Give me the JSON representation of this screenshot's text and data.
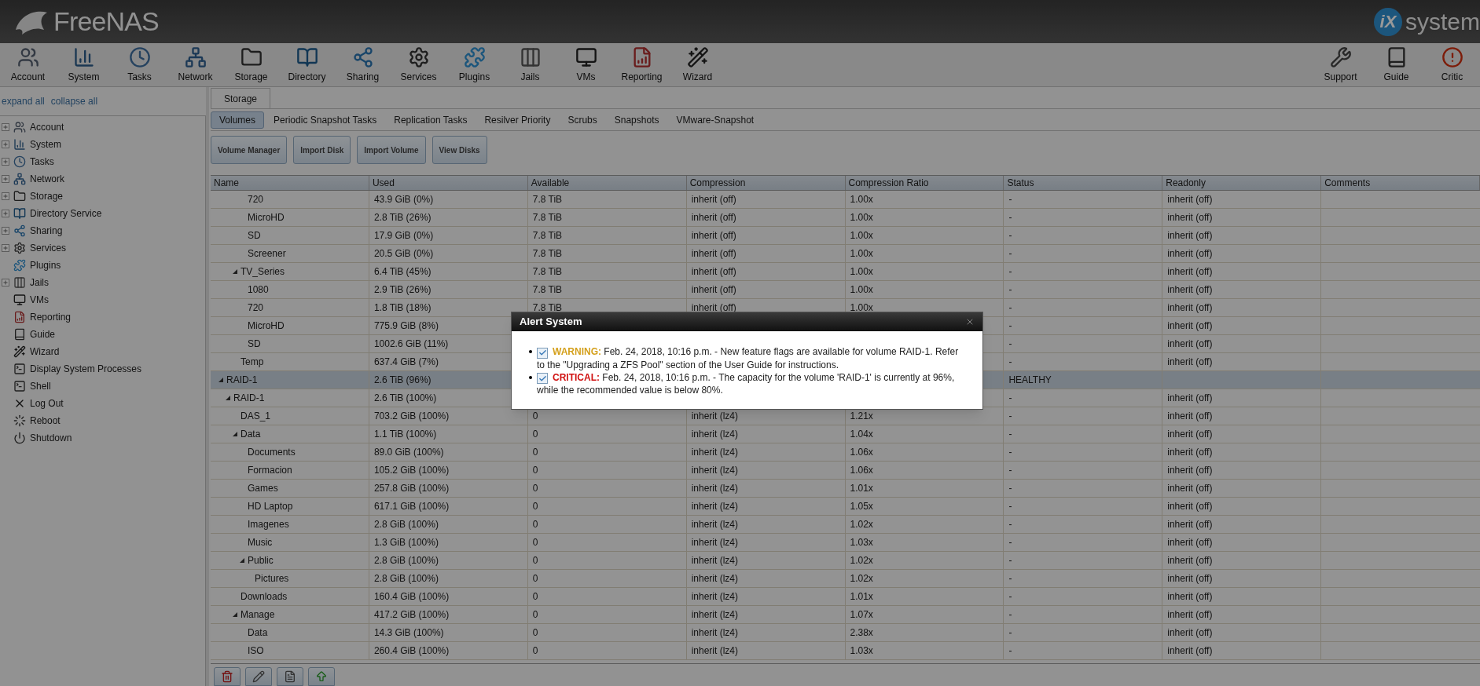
{
  "header": {
    "logo": "FreeNAS",
    "brand_mark": "iX",
    "brand_text": "system"
  },
  "toolbar": {
    "left": [
      "Account",
      "System",
      "Tasks",
      "Network",
      "Storage",
      "Directory",
      "Sharing",
      "Services",
      "Plugins",
      "Jails",
      "VMs",
      "Reporting",
      "Wizard"
    ],
    "right": [
      "Support",
      "Guide",
      "Critic"
    ]
  },
  "sidebar": {
    "links": [
      "expand all",
      "collapse all"
    ],
    "items": [
      {
        "label": "Account",
        "kind": "group",
        "expanded": false
      },
      {
        "label": "System",
        "kind": "group",
        "expanded": false
      },
      {
        "label": "Tasks",
        "kind": "group",
        "expanded": false
      },
      {
        "label": "Network",
        "kind": "group",
        "expanded": false
      },
      {
        "label": "Storage",
        "kind": "group",
        "expanded": false
      },
      {
        "label": "Directory Service",
        "kind": "group",
        "expanded": false
      },
      {
        "label": "Sharing",
        "kind": "group",
        "expanded": false
      },
      {
        "label": "Services",
        "kind": "group",
        "expanded": false
      },
      {
        "label": "Plugins",
        "kind": "item"
      },
      {
        "label": "Jails",
        "kind": "group",
        "expanded": false
      },
      {
        "label": "VMs",
        "kind": "item"
      },
      {
        "label": "Reporting",
        "kind": "item"
      },
      {
        "label": "Guide",
        "kind": "item"
      },
      {
        "label": "Wizard",
        "kind": "item"
      },
      {
        "label": "Display System Processes",
        "kind": "item"
      },
      {
        "label": "Shell",
        "kind": "item"
      },
      {
        "label": "Log Out",
        "kind": "item"
      },
      {
        "label": "Reboot",
        "kind": "item"
      },
      {
        "label": "Shutdown",
        "kind": "item"
      }
    ]
  },
  "main_tab": {
    "label": "Storage",
    "selected": true
  },
  "subtabs": [
    {
      "label": "Volumes",
      "selected": true
    },
    {
      "label": "Periodic Snapshot Tasks",
      "selected": false
    },
    {
      "label": "Replication Tasks",
      "selected": false
    },
    {
      "label": "Resilver Priority",
      "selected": false
    },
    {
      "label": "Scrubs",
      "selected": false
    },
    {
      "label": "Snapshots",
      "selected": false
    },
    {
      "label": "VMware-Snapshot",
      "selected": false
    }
  ],
  "buttons": [
    "Volume Manager",
    "Import Disk",
    "Import Volume",
    "View Disks"
  ],
  "table": {
    "columns": [
      "Name",
      "Used",
      "Available",
      "Compression",
      "Compression Ratio",
      "Status",
      "Readonly",
      "Comments"
    ],
    "rows": [
      {
        "children": [
          {
            "children": [
              {
                "children": [
                  {
                    "kind": "dataset",
                    "name": "720",
                    "used": "43.9 GiB (0%)",
                    "available": "7.8 TiB",
                    "compression": "inherit (off)",
                    "ratio": "1.00x",
                    "status": "-",
                    "readonly": "inherit (off)"
                  },
                  {
                    "kind": "dataset",
                    "name": "MicroHD",
                    "used": "2.8 TiB (26%)",
                    "available": "7.8 TiB",
                    "compression": "inherit (off)",
                    "ratio": "1.00x",
                    "status": "-",
                    "readonly": "inherit (off)"
                  },
                  {
                    "kind": "dataset",
                    "name": "SD",
                    "used": "17.9 GiB (0%)",
                    "available": "7.8 TiB",
                    "compression": "inherit (off)",
                    "ratio": "1.00x",
                    "status": "-",
                    "readonly": "inherit (off)"
                  },
                  {
                    "kind": "dataset",
                    "name": "Screener",
                    "used": "20.5 GiB (0%)",
                    "available": "7.8 TiB",
                    "compression": "inherit (off)",
                    "ratio": "1.00x",
                    "status": "-",
                    "readonly": "inherit (off)"
                  }
                ]
              },
              {
                "kind": "dataset",
                "name": "TV_Series",
                "expanded": true,
                "used": "6.4 TiB (45%)",
                "available": "7.8 TiB",
                "compression": "inherit (off)",
                "ratio": "1.00x",
                "status": "-",
                "readonly": "inherit (off)",
                "children": [
                  {
                    "kind": "dataset",
                    "name": "1080",
                    "used": "2.9 TiB (26%)",
                    "available": "7.8 TiB",
                    "compression": "inherit (off)",
                    "ratio": "1.00x",
                    "status": "-",
                    "readonly": "inherit (off)"
                  },
                  {
                    "kind": "dataset",
                    "name": "720",
                    "used": "1.8 TiB (18%)",
                    "available": "7.8 TiB",
                    "compression": "inherit (off)",
                    "ratio": "1.00x",
                    "status": "-",
                    "readonly": "inherit (off)"
                  },
                  {
                    "kind": "dataset",
                    "name": "MicroHD",
                    "used": "775.9 GiB (8%)",
                    "status": "-",
                    "readonly": "inherit (off)"
                  },
                  {
                    "kind": "dataset",
                    "name": "SD",
                    "used": "1002.6 GiB (11%)",
                    "status": "-",
                    "readonly": "inherit (off)"
                  }
                ]
              },
              {
                "kind": "dataset",
                "name": "Temp",
                "used": "637.4 GiB (7%)",
                "status": "-",
                "readonly": "inherit (off)"
              }
            ]
          }
        ]
      },
      {
        "kind": "volume",
        "name": "RAID-1",
        "expanded": true,
        "used": "2.6 TiB (96%)",
        "status": "HEALTHY",
        "children": [
          {
            "kind": "dataset",
            "name": "RAID-1",
            "expanded": true,
            "used": "2.6 TiB (100%)",
            "status": "-",
            "readonly": "inherit (off)",
            "children": [
              {
                "kind": "dataset",
                "name": "DAS_1",
                "used": "703.2 GiB (100%)",
                "available": "0",
                "compression": "inherit (lz4)",
                "ratio": "1.21x",
                "status": "-",
                "readonly": "inherit (off)"
              },
              {
                "kind": "dataset",
                "name": "Data",
                "expanded": true,
                "used": "1.1 TiB (100%)",
                "available": "0",
                "compression": "inherit (lz4)",
                "ratio": "1.04x",
                "status": "-",
                "readonly": "inherit (off)",
                "children": [
                  {
                    "kind": "dataset",
                    "name": "Documents",
                    "used": "89.0 GiB (100%)",
                    "available": "0",
                    "compression": "inherit (lz4)",
                    "ratio": "1.06x",
                    "status": "-",
                    "readonly": "inherit (off)"
                  },
                  {
                    "kind": "dataset",
                    "name": "Formacion",
                    "used": "105.2 GiB (100%)",
                    "available": "0",
                    "compression": "inherit (lz4)",
                    "ratio": "1.06x",
                    "status": "-",
                    "readonly": "inherit (off)"
                  },
                  {
                    "kind": "dataset",
                    "name": "Games",
                    "used": "257.8 GiB (100%)",
                    "available": "0",
                    "compression": "inherit (lz4)",
                    "ratio": "1.01x",
                    "status": "-",
                    "readonly": "inherit (off)"
                  },
                  {
                    "kind": "dataset",
                    "name": "HD Laptop",
                    "used": "617.1 GiB (100%)",
                    "available": "0",
                    "compression": "inherit (lz4)",
                    "ratio": "1.05x",
                    "status": "-",
                    "readonly": "inherit (off)"
                  },
                  {
                    "kind": "dataset",
                    "name": "Imagenes",
                    "used": "2.8 GiB (100%)",
                    "available": "0",
                    "compression": "inherit (lz4)",
                    "ratio": "1.02x",
                    "status": "-",
                    "readonly": "inherit (off)"
                  },
                  {
                    "kind": "dataset",
                    "name": "Music",
                    "used": "1.3 GiB (100%)",
                    "available": "0",
                    "compression": "inherit (lz4)",
                    "ratio": "1.03x",
                    "status": "-",
                    "readonly": "inherit (off)"
                  },
                  {
                    "kind": "dataset",
                    "name": "Public",
                    "expanded": true,
                    "used": "2.8 GiB (100%)",
                    "available": "0",
                    "compression": "inherit (lz4)",
                    "ratio": "1.02x",
                    "status": "-",
                    "readonly": "inherit (off)",
                    "children": [
                      {
                        "kind": "dataset",
                        "name": "Pictures",
                        "used": "2.8 GiB (100%)",
                        "available": "0",
                        "compression": "inherit (lz4)",
                        "ratio": "1.02x",
                        "status": "-",
                        "readonly": "inherit (off)"
                      }
                    ]
                  }
                ]
              },
              {
                "kind": "dataset",
                "name": "Downloads",
                "used": "160.4 GiB (100%)",
                "available": "0",
                "compression": "inherit (lz4)",
                "ratio": "1.01x",
                "status": "-",
                "readonly": "inherit (off)"
              },
              {
                "kind": "dataset",
                "name": "Manage",
                "expanded": true,
                "used": "417.2 GiB (100%)",
                "available": "0",
                "compression": "inherit (lz4)",
                "ratio": "1.07x",
                "status": "-",
                "readonly": "inherit (off)",
                "children": [
                  {
                    "kind": "dataset",
                    "name": "Data",
                    "used": "14.3 GiB (100%)",
                    "available": "0",
                    "compression": "inherit (lz4)",
                    "ratio": "2.38x",
                    "status": "-",
                    "readonly": "inherit (off)"
                  },
                  {
                    "kind": "dataset",
                    "name": "ISO",
                    "used": "260.4 GiB (100%)",
                    "available": "0",
                    "compression": "inherit (lz4)",
                    "ratio": "1.03x",
                    "status": "-",
                    "readonly": "inherit (off)"
                  }
                ]
              }
            ]
          }
        ]
      }
    ]
  },
  "dialog": {
    "title": "Alert System",
    "alerts": [
      {
        "kind": "warning",
        "checked": true,
        "label": "WARNING:",
        "text": "Feb. 24, 2018, 10:16 p.m. - New feature flags are available for volume RAID-1. Refer to the \"Upgrading a ZFS Pool\" section of the User Guide for instructions."
      },
      {
        "kind": "critical",
        "checked": true,
        "label": "CRITICAL:",
        "text": "Feb. 24, 2018, 10:16 p.m. - The capacity for the volume 'RAID-1' is currently at 96%, while the recommended value is below 80%."
      }
    ]
  }
}
